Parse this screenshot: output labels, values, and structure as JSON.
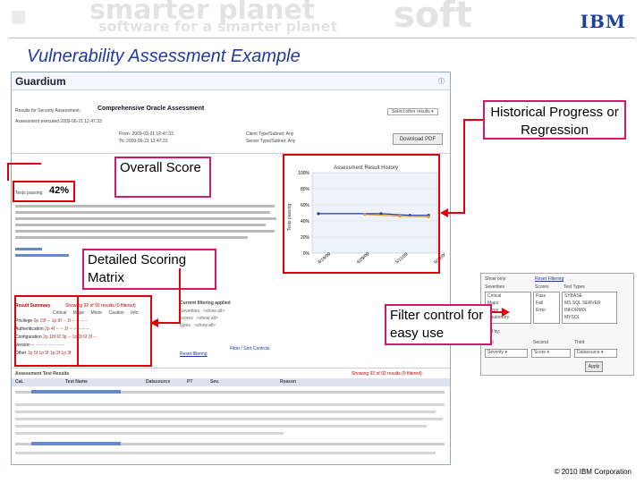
{
  "banner": {
    "watermark_1": "smarter planet",
    "watermark_2": "software for a smarter planet",
    "watermark_3": "soft",
    "logo": "IBM"
  },
  "slide": {
    "title": "Vulnerability Assessment Example",
    "footer": "© 2010 IBM Corporation"
  },
  "callouts": {
    "historical": "Historical Progress or Regression",
    "overall": "Overall Score",
    "detailed": "Detailed Scoring Matrix",
    "filter": "Filter control for easy use"
  },
  "app": {
    "product": "Guardium",
    "assessment_title": "Comprehensive Oracle Assessment",
    "executed": "Assessment executed 2009-06-21 12:47:33",
    "from": "From: 2009-03-21 12:47:33",
    "to": "To: 2009-06-21 12:47:33",
    "client": "Client Type/Subnet: Any",
    "server": "Server Type/Subnet: Any",
    "download": "Download PDF",
    "tests_passing_label": "Tests passing:",
    "tests_passing_value": "42%",
    "chart_title": "Assessment Result History",
    "chart_ylabel": "Tests passing",
    "result_summary": "Result Summary",
    "showing": "Showing 92 of 92 results (0 filtered)",
    "current_filtering": "Current filtering applied",
    "reset_filtering": "Reset filtering",
    "filter_sort_controls": "Filter / Sort Controls",
    "results_header": "Assessment Test Results",
    "columns": [
      "Cat.",
      "Test Name",
      "Datasource",
      "PT",
      "Sev.",
      "Reason"
    ]
  },
  "filter_panel": {
    "show_only": "Show only:",
    "reset": "Reset Filtering",
    "severities_label": "Severities",
    "scores_label": "Scores",
    "test_types_label": "Test Types",
    "severities": [
      "Critical",
      "Major",
      "Minor",
      "Cautionary"
    ],
    "scores": [
      "Pass",
      "Fail",
      "Error"
    ],
    "test_types": [
      "SYBASE",
      "MS SQL SERVER",
      "INFORMIX",
      "MYSQL"
    ],
    "sort_by": "Sort by:",
    "first": "First",
    "second": "Second",
    "third": "Third",
    "first_val": "Severity",
    "second_val": "Score",
    "third_val": "Datasource",
    "apply": "Apply"
  },
  "chart_data": {
    "type": "line",
    "title": "Assessment Result History",
    "ylabel": "Tests passing",
    "y_ticks": [
      "100%",
      "80%",
      "60%",
      "40%",
      "20%",
      "0%"
    ],
    "x_ticks": [
      "4/19/09",
      "4/29/09",
      "5/11/09",
      "6/22/09"
    ],
    "ylim": [
      0,
      100
    ],
    "series": [
      {
        "values": [
          {
            "x": 0.05,
            "y": 49
          },
          {
            "x": 0.55,
            "y": 49
          },
          {
            "x": 0.78,
            "y": 47
          },
          {
            "x": 0.93,
            "y": 47
          }
        ],
        "color": "#1f3aa0"
      },
      {
        "values": [
          {
            "x": 0.42,
            "y": 48
          },
          {
            "x": 0.7,
            "y": 46
          },
          {
            "x": 0.93,
            "y": 45
          }
        ],
        "color": "#e0a030"
      }
    ],
    "grid": true
  },
  "summary_rows": [
    {
      "label": "Privilege",
      "vals": "0p 19f -- 1p 6f -- 1f -- -- -- --"
    },
    {
      "label": "Authentication",
      "vals": "2p 4f -- -- 1f -- -- -- -- --"
    },
    {
      "label": "Configuration",
      "vals": "2p 18f 6f 3p -- 1p 3f 6f 3f --"
    },
    {
      "label": "Version",
      "vals": "-- -- -- -- -- -- -- --"
    },
    {
      "label": "Other",
      "vals": "1p 5f 1p 5f 1p 3f 1p 3f"
    }
  ],
  "summary_cols": [
    "Critical",
    "Major",
    "Minor",
    "Caution",
    "Info"
  ]
}
